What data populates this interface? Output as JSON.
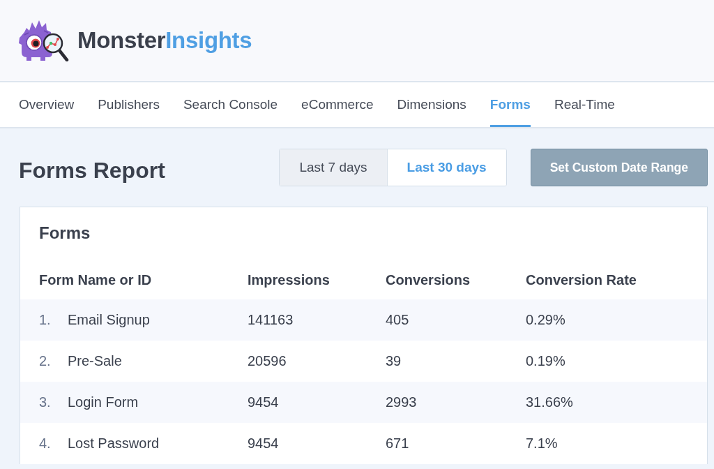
{
  "brand": {
    "wordmark": [
      "Monster",
      "Insights"
    ]
  },
  "tabs": [
    {
      "label": "Overview",
      "selected": false
    },
    {
      "label": "Publishers",
      "selected": false
    },
    {
      "label": "Search Console",
      "selected": false
    },
    {
      "label": "eCommerce",
      "selected": false
    },
    {
      "label": "Dimensions",
      "selected": false
    },
    {
      "label": "Forms",
      "selected": true
    },
    {
      "label": "Real-Time",
      "selected": false
    }
  ],
  "report": {
    "title": "Forms Report",
    "date_ranges": [
      {
        "label": "Last 7 days",
        "selected": false
      },
      {
        "label": "Last 30 days",
        "selected": true
      }
    ],
    "custom_range_button": "Set Custom Date Range"
  },
  "forms_table": {
    "title": "Forms",
    "columns": [
      "Form Name or ID",
      "Impressions",
      "Conversions",
      "Conversion Rate"
    ],
    "rows": [
      {
        "number": "1.",
        "name": "Email Signup",
        "impressions": "141163",
        "conversions": "405",
        "rate": "0.29%"
      },
      {
        "number": "2.",
        "name": "Pre-Sale",
        "impressions": "20596",
        "conversions": "39",
        "rate": "0.19%"
      },
      {
        "number": "3.",
        "name": "Login Form",
        "impressions": "9454",
        "conversions": "2993",
        "rate": "31.66%"
      },
      {
        "number": "4.",
        "name": "Lost Password",
        "impressions": "9454",
        "conversions": "671",
        "rate": "7.1%"
      }
    ]
  }
}
